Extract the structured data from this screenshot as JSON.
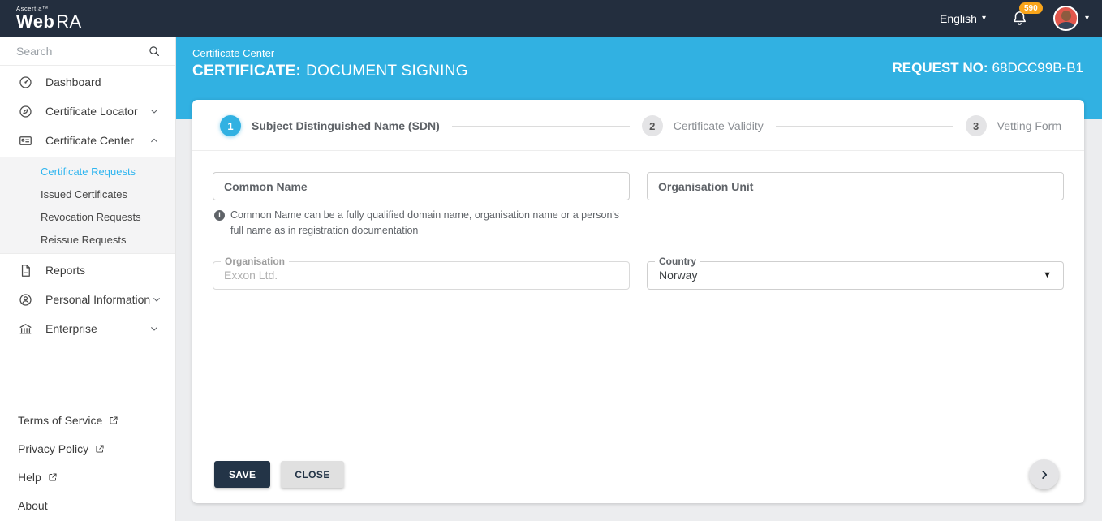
{
  "topbar": {
    "brand_sup": "Ascertia™",
    "brand_bold": "Web",
    "brand_light": "RA",
    "language": "English",
    "notifications_count": "590"
  },
  "header": {
    "breadcrumb": "Certificate Center",
    "title_label": "CERTIFICATE:",
    "title_value": "DOCUMENT SIGNING",
    "request_label": "REQUEST NO:",
    "request_value": "68DCC99B-B1"
  },
  "sidebar": {
    "search_placeholder": "Search",
    "items": [
      {
        "label": "Dashboard",
        "icon": "dashboard-icon"
      },
      {
        "label": "Certificate Locator",
        "icon": "compass-icon",
        "chevron": "down"
      },
      {
        "label": "Certificate Center",
        "icon": "id-card-icon",
        "chevron": "up",
        "expanded": true
      }
    ],
    "submenu_items": [
      {
        "label": "Certificate Requests",
        "active": true
      },
      {
        "label": "Issued Certificates",
        "active": false
      },
      {
        "label": "Revocation Requests",
        "active": false
      },
      {
        "label": "Reissue Requests",
        "active": false
      }
    ],
    "items_lower": [
      {
        "label": "Reports",
        "icon": "document-icon"
      },
      {
        "label": "Personal Information",
        "icon": "person-icon",
        "chevron": "down"
      },
      {
        "label": "Enterprise",
        "icon": "bank-icon",
        "chevron": "down"
      }
    ],
    "footer_links": [
      {
        "label": "Terms of Service",
        "external": true
      },
      {
        "label": "Privacy Policy",
        "external": true
      },
      {
        "label": "Help",
        "external": true
      },
      {
        "label": "About",
        "external": false
      }
    ]
  },
  "stepper": {
    "steps": [
      {
        "number": "1",
        "label": "Subject Distinguished Name (SDN)",
        "active": true
      },
      {
        "number": "2",
        "label": "Certificate Validity",
        "active": false
      },
      {
        "number": "3",
        "label": "Vetting Form",
        "active": false
      }
    ]
  },
  "form": {
    "common_name_placeholder": "Common Name",
    "organisation_unit_placeholder": "Organisation Unit",
    "common_name_hint": "Common Name can be a fully qualified domain name, organisation name or a person's full name as in registration documentation",
    "organisation_label": "Organisation",
    "organisation_placeholder": "Exxon Ltd.",
    "country_label": "Country",
    "country_value": "Norway"
  },
  "actions": {
    "save_label": "SAVE",
    "close_label": "CLOSE"
  },
  "icons": {
    "caret_down_glyph": "▾",
    "select_caret_glyph": "▼",
    "info_glyph": "i"
  },
  "colors": {
    "topbar-bg": "#232e3e",
    "accent-blue": "#31b1e2",
    "active-link": "#2eb5f0",
    "badge-orange": "#f9a51a",
    "save-bg": "#233447",
    "page-bg": "#ecedef"
  }
}
